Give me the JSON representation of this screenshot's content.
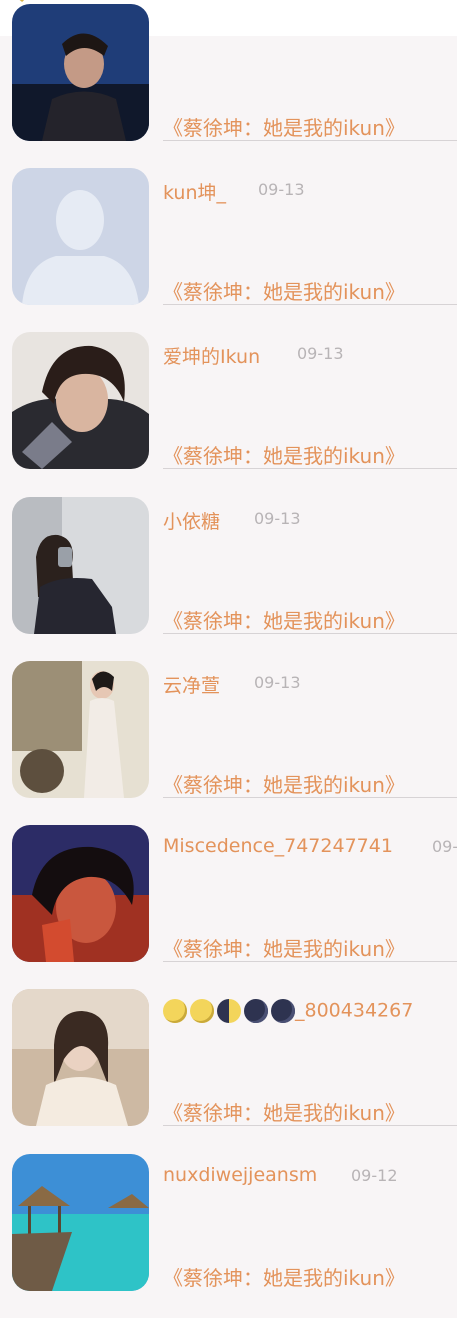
{
  "list": {
    "items": [
      {
        "name": "",
        "date": "",
        "title": "《蔡徐坤：她是我的ikun》"
      },
      {
        "name": "kun坤_",
        "date": "09-13",
        "title": "《蔡徐坤：她是我的ikun》"
      },
      {
        "name": "爱坤的Ikun",
        "date": "09-13",
        "title": "《蔡徐坤：她是我的ikun》"
      },
      {
        "name": "小依糖",
        "date": "09-13",
        "title": "《蔡徐坤：她是我的ikun》"
      },
      {
        "name": "云净萱",
        "date": "09-13",
        "title": "《蔡徐坤：她是我的ikun》"
      },
      {
        "name": "Miscedence_747247741",
        "date": "09-",
        "title": "《蔡徐坤：她是我的ikun》"
      },
      {
        "name": "🌕🌕🌓🌑🌑_800434267",
        "date": "",
        "title": "《蔡徐坤：她是我的ikun》"
      },
      {
        "name": "nuxdiwejjeansm",
        "date": "09-12",
        "title": "《蔡徐坤：她是我的ikun》"
      }
    ]
  },
  "colors": {
    "accent": "#e3935b",
    "date": "#b8b4b6",
    "background": "#f8f5f6"
  }
}
